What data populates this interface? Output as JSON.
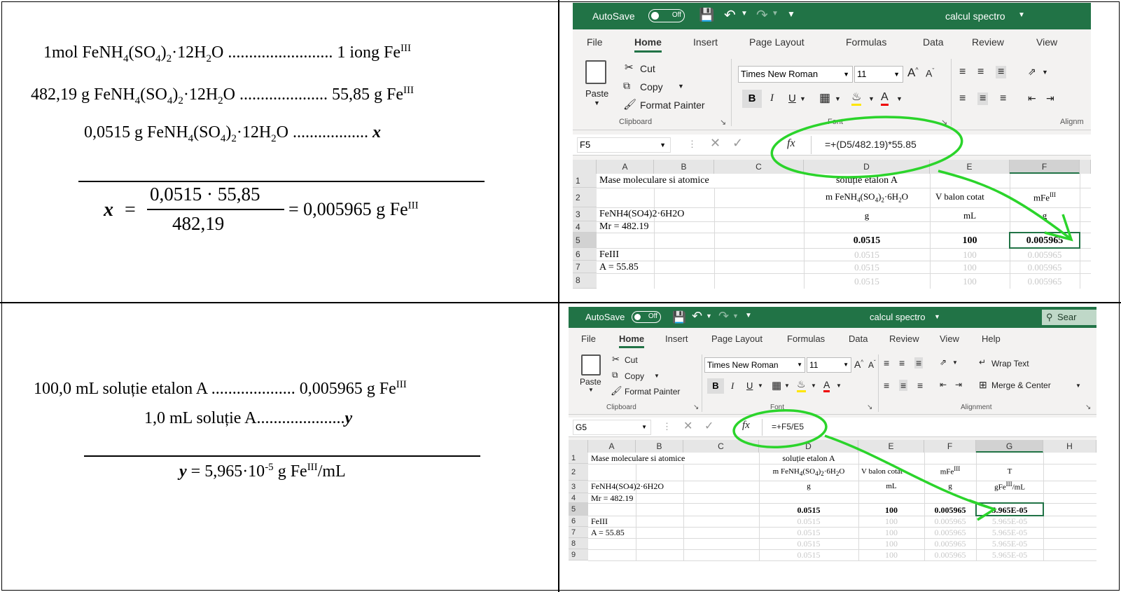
{
  "row1": {
    "l1": {
      "a": "1mol FeNH",
      "b": "4",
      "c": "(SO",
      "d": "4",
      "e": ")",
      "f": "2",
      "g": "·12H",
      "h": "2",
      "i": "O ......................... 1 iong Fe",
      "j": "III"
    },
    "l2": {
      "a": "482,19 g FeNH",
      "b": "4",
      "c": "(SO",
      "d": "4",
      "e": ")",
      "f": "2",
      "g": "·12H",
      "h": "2",
      "i": "O ..................... 55,85 g Fe",
      "j": "III"
    },
    "l3": {
      "a": "0,0515 g FeNH",
      "b": "4",
      "c": "(SO",
      "d": "4",
      "e": ")",
      "f": "2",
      "g": "·12H",
      "h": "2",
      "i": "O ..................",
      "x": "x"
    },
    "eq": {
      "lhs": "x",
      "eqsign": "=",
      "num": "0,0515 · 55,85",
      "den": "482,19",
      "rhs": "= 0,005965 g Fe",
      "sup": "III"
    }
  },
  "row2": {
    "l1": {
      "a": "100,0 mL soluție etalon A .................... 0,005965 g Fe",
      "sup": "III"
    },
    "l2": {
      "a": "1,0 mL soluție A.....................",
      "y": "y"
    },
    "l3": {
      "y": "y",
      "a": " = 5,965·10",
      "exp": "-5",
      "b": " g Fe",
      "sup": "III",
      "c": "/mL"
    }
  },
  "excel1": {
    "autosave": "AutoSave",
    "toggle": "Off",
    "title": "calcul spectro",
    "menu": [
      "File",
      "Home",
      "Insert",
      "Page Layout",
      "Formulas",
      "Data",
      "Review",
      "View"
    ],
    "clipboard": {
      "paste": "Paste",
      "cut": "Cut",
      "copy": "Copy",
      "painter": "Format Painter",
      "group": "Clipboard"
    },
    "font": {
      "name": "Times New Roman",
      "size": "11",
      "group": "Font",
      "bold": "B",
      "italic": "I",
      "underline": "U",
      "grow": "A",
      "shrink": "A",
      "color": "A"
    },
    "align_group": "Alignm",
    "namebox": "F5",
    "fx": "fx",
    "formula": "=+(D5/482.19)*55.85",
    "cols": [
      "A",
      "B",
      "C",
      "D",
      "E",
      "F"
    ],
    "rows": [
      "1",
      "2",
      "3",
      "4",
      "5",
      "6",
      "7",
      "8"
    ],
    "cells": {
      "a1": "Mase moleculare si atomice",
      "d1": "soluție etalon A",
      "d2a": "m FeNH",
      "d2b": "4",
      "d2c": "(SO",
      "d2d": "4",
      "d2e": ")",
      "d2f": "2",
      "d2g": "·6H",
      "d2h": "2",
      "d2i": "O",
      "e2": "V balon cotat",
      "f2": "mFe",
      "f2s": "III",
      "a3": "FeNH4(SO4)2·6H2O",
      "d3": "g",
      "e3": "mL",
      "f3": "g",
      "a4": "Mr = 482.19",
      "d5": "0.0515",
      "e5": "100",
      "f5": "0.005965",
      "a6": "FeIII",
      "a7": "A = 55.85",
      "ghost": {
        "d": "0.0515",
        "e": "100",
        "f": "0.005965"
      }
    }
  },
  "excel2": {
    "autosave": "AutoSave",
    "toggle": "Off",
    "title": "calcul spectro",
    "search": "Sear",
    "menu": [
      "File",
      "Home",
      "Insert",
      "Page Layout",
      "Formulas",
      "Data",
      "Review",
      "View",
      "Help"
    ],
    "clipboard": {
      "paste": "Paste",
      "cut": "Cut",
      "copy": "Copy",
      "painter": "Format Painter",
      "group": "Clipboard"
    },
    "font": {
      "name": "Times New Roman",
      "size": "11",
      "group": "Font",
      "bold": "B",
      "italic": "I",
      "underline": "U",
      "grow": "A",
      "shrink": "A",
      "color": "A"
    },
    "wrap": "Wrap Text",
    "merge": "Merge & Center",
    "align_group": "Alignment",
    "namebox": "G5",
    "fx": "fx",
    "formula": "=+F5/E5",
    "cols": [
      "A",
      "B",
      "C",
      "D",
      "E",
      "F",
      "G",
      "H"
    ],
    "rows": [
      "1",
      "2",
      "3",
      "4",
      "5",
      "6",
      "7",
      "8",
      "9"
    ],
    "cells": {
      "a1": "Mase moleculare si atomice",
      "d1": "soluție etalon A",
      "d2a": "m FeNH",
      "d2b": "4",
      "d2c": "(SO",
      "d2d": "4",
      "d2e": ")",
      "d2f": "2",
      "d2g": "·6H",
      "d2h": "2",
      "d2i": "O",
      "e2": "V balon cotat",
      "f2": "mFe",
      "f2s": "III",
      "g2": "T",
      "a3": "FeNH4(SO4)2·6H2O",
      "d3": "g",
      "e3": "mL",
      "f3": "g",
      "g3a": "gFe",
      "g3s": "III",
      "g3b": "/mL",
      "a4": "Mr = 482.19",
      "d5": "0.0515",
      "e5": "100",
      "f5": "0.005965",
      "g5": "5.965E-05",
      "a6": "FeIII",
      "a7": "A = 55.85",
      "ghost": {
        "d": "0.0515",
        "e": "100",
        "f": "0.005965",
        "g": "5.965E-05"
      }
    }
  },
  "colors": {
    "excel_green": "#217346",
    "annotation_green": "#2bd42b"
  }
}
